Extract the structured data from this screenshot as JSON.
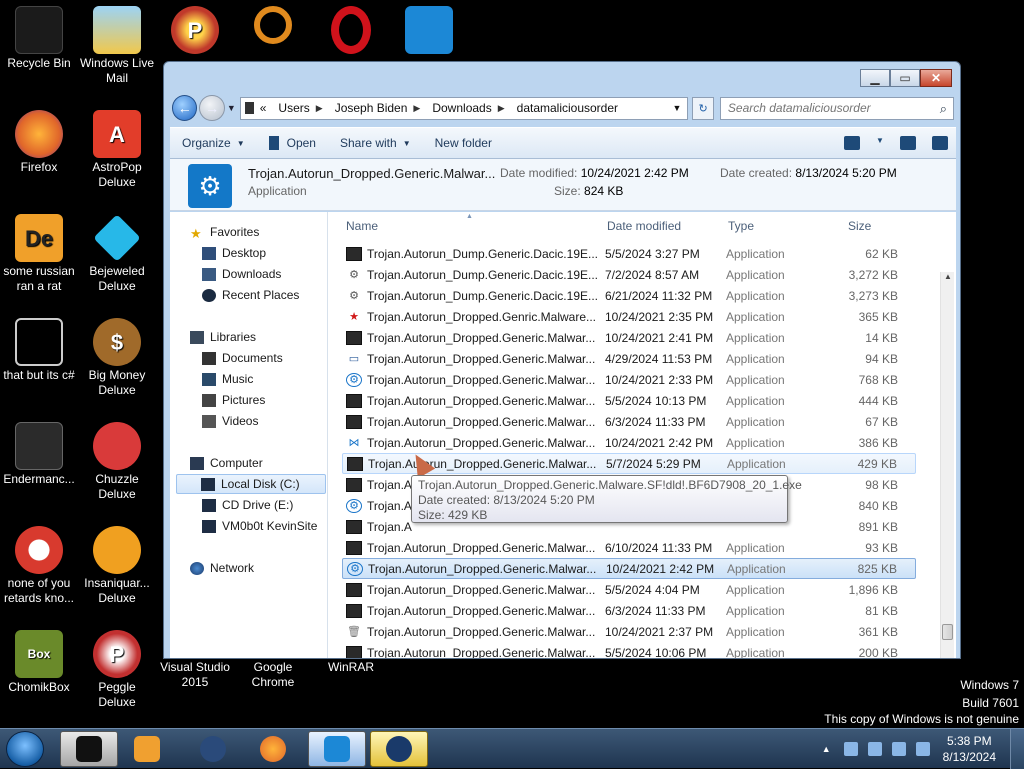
{
  "desktop": {
    "icons": [
      {
        "label": "Recycle Bin",
        "color": "#1b1b1b"
      },
      {
        "label": "Windows Live Mail",
        "color": "#f1c84b"
      },
      {
        "label": "",
        "color": "#c0392b"
      },
      {
        "label": "",
        "color": "#e08a1e"
      },
      {
        "label": "",
        "color": "#d0121b"
      },
      {
        "label": "",
        "color": "#1c88d6"
      },
      {
        "label": "Firefox",
        "color": "#e0662a"
      },
      {
        "label": "AstroPop Deluxe",
        "color": "#e23d2a"
      },
      {
        "label": "some russian ran a rat",
        "color": "#f0a02a"
      },
      {
        "label": "Bejeweled Deluxe",
        "color": "#27b8e8"
      },
      {
        "label": "that but its c#",
        "color": "#8a8a8a"
      },
      {
        "label": "Big Money Deluxe",
        "color": "#a06a2a"
      },
      {
        "label": "Endermanc...",
        "color": "#2b2b2b"
      },
      {
        "label": "Chuzzle Deluxe",
        "color": "#d93a3a"
      },
      {
        "label": "none of you retards kno...",
        "color": "#d83a2e"
      },
      {
        "label": "Insaniquar... Deluxe",
        "color": "#f0a020"
      },
      {
        "label": "ChomikBox",
        "color": "#6a8a2a"
      },
      {
        "label": "Peggle Deluxe",
        "color": "#c23030"
      },
      {
        "label": "Visual Studio 2015",
        "color": "#6a3c9a"
      },
      {
        "label": "Google Chrome",
        "color": "#2fa84f"
      },
      {
        "label": "WinRAR",
        "color": "#8a2a5a"
      }
    ],
    "watermark": [
      "Windows 7",
      "Build 7601",
      "This copy of Windows is not genuine"
    ]
  },
  "explorer": {
    "address": {
      "chevrons": "«",
      "path": [
        "Users",
        "Joseph Biden",
        "Downloads",
        "datamaliciousorder"
      ]
    },
    "search": {
      "placeholder": "Search datamaliciousorder"
    },
    "toolbar": {
      "organize": "Organize",
      "open": "Open",
      "share_with": "Share with",
      "new_folder": "New folder"
    },
    "details": {
      "name": "Trojan.Autorun_Dropped.Generic.Malwar...",
      "type": "Application",
      "modified_label": "Date modified:",
      "modified": "10/24/2021 2:42 PM",
      "size_label": "Size:",
      "size": "824 KB",
      "created_label": "Date created:",
      "created": "8/13/2024 5:20 PM"
    },
    "nav": {
      "favorites": "Favorites",
      "desktop": "Desktop",
      "downloads": "Downloads",
      "recent_places": "Recent Places",
      "libraries": "Libraries",
      "documents": "Documents",
      "music": "Music",
      "pictures": "Pictures",
      "videos": "Videos",
      "computer": "Computer",
      "local_disk": "Local Disk (C:)",
      "cd_drive": "CD Drive (E:)",
      "vm": "VM0b0t KevinSite",
      "network": "Network"
    },
    "columns": {
      "name": "Name",
      "date": "Date modified",
      "type": "Type",
      "size": "Size"
    },
    "files": [
      {
        "name": "Trojan.Autorun_Dump.Generic.Dacic.19E...",
        "date": "5/5/2024 3:27 PM",
        "type": "Application",
        "size": "62 KB",
        "icon": "cli"
      },
      {
        "name": "Trojan.Autorun_Dump.Generic.Dacic.19E...",
        "date": "7/2/2024 8:57 AM",
        "type": "Application",
        "size": "3,272 KB",
        "icon": "setup"
      },
      {
        "name": "Trojan.Autorun_Dump.Generic.Dacic.19E...",
        "date": "6/21/2024 11:32 PM",
        "type": "Application",
        "size": "3,273 KB",
        "icon": "setup"
      },
      {
        "name": "Trojan.Autorun_Dropped.Genric.Malware...",
        "date": "10/24/2021 2:35 PM",
        "type": "Application",
        "size": "365 KB",
        "icon": "star"
      },
      {
        "name": "Trojan.Autorun_Dropped.Generic.Malwar...",
        "date": "10/24/2021 2:41 PM",
        "type": "Application",
        "size": "14 KB",
        "icon": "cli"
      },
      {
        "name": "Trojan.Autorun_Dropped.Generic.Malwar...",
        "date": "4/29/2024 11:53 PM",
        "type": "Application",
        "size": "94 KB",
        "icon": "window"
      },
      {
        "name": "Trojan.Autorun_Dropped.Generic.Malwar...",
        "date": "10/24/2021 2:33 PM",
        "type": "Application",
        "size": "768 KB",
        "icon": "gear"
      },
      {
        "name": "Trojan.Autorun_Dropped.Generic.Malwar...",
        "date": "5/5/2024 10:13 PM",
        "type": "Application",
        "size": "444 KB",
        "icon": "cli"
      },
      {
        "name": "Trojan.Autorun_Dropped.Generic.Malwar...",
        "date": "6/3/2024 11:33 PM",
        "type": "Application",
        "size": "67 KB",
        "icon": "cli"
      },
      {
        "name": "Trojan.Autorun_Dropped.Generic.Malwar...",
        "date": "10/24/2021 2:42 PM",
        "type": "Application",
        "size": "386 KB",
        "icon": "vs"
      },
      {
        "name": "Trojan.Autorun_Dropped.Generic.Malwar...",
        "date": "5/7/2024 5:29 PM",
        "type": "Application",
        "size": "429 KB",
        "icon": "cli"
      },
      {
        "name": "Trojan.A",
        "date": "",
        "type": "",
        "size": "98 KB",
        "icon": "cli"
      },
      {
        "name": "Trojan.A",
        "date": "",
        "type": "",
        "size": "840 KB",
        "icon": "gear"
      },
      {
        "name": "Trojan.A",
        "date": "",
        "type": "",
        "size": "891 KB",
        "icon": "cli"
      },
      {
        "name": "Trojan.Autorun_Dropped.Generic.Malwar...",
        "date": "6/10/2024 11:33 PM",
        "type": "Application",
        "size": "93 KB",
        "icon": "cli"
      },
      {
        "name": "Trojan.Autorun_Dropped.Generic.Malwar...",
        "date": "10/24/2021 2:42 PM",
        "type": "Application",
        "size": "825 KB",
        "icon": "gear"
      },
      {
        "name": "Trojan.Autorun_Dropped.Generic.Malwar...",
        "date": "5/5/2024 4:04 PM",
        "type": "Application",
        "size": "1,896 KB",
        "icon": "cli"
      },
      {
        "name": "Trojan.Autorun_Dropped.Generic.Malwar...",
        "date": "6/3/2024 11:33 PM",
        "type": "Application",
        "size": "81 KB",
        "icon": "cli"
      },
      {
        "name": "Trojan.Autorun_Dropped.Generic.Malwar...",
        "date": "10/24/2021 2:37 PM",
        "type": "Application",
        "size": "361 KB",
        "icon": "trash"
      },
      {
        "name": "Trojan.Autorun_Dropped.Generic.Malwar...",
        "date": "5/5/2024 10:06 PM",
        "type": "Application",
        "size": "200 KB",
        "icon": "cli"
      }
    ],
    "tooltip": {
      "line1": "Trojan.Autorun_Dropped.Generic.Malware.SF!dld!.BF6D7908_20_1.exe",
      "line2": "Date created: 8/13/2024 5:20 PM",
      "line3": "Size: 429 KB"
    }
  },
  "taskbar": {
    "time": "5:38 PM",
    "date": "8/13/2024"
  }
}
